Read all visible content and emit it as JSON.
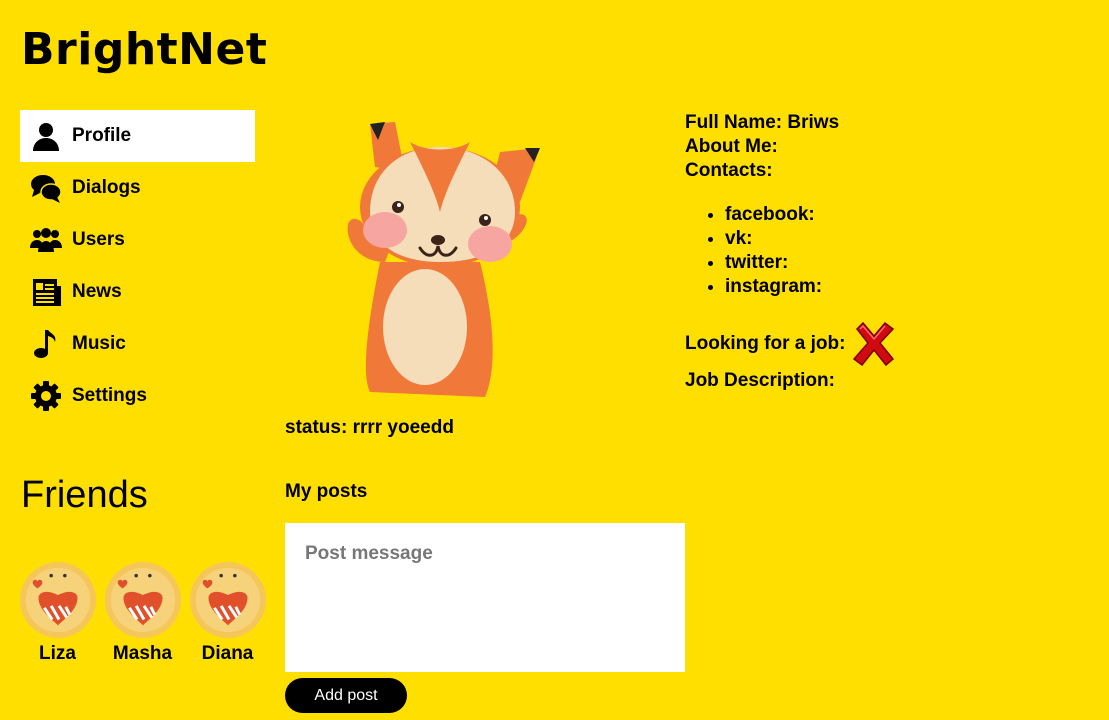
{
  "app": {
    "logo": "BrightNet"
  },
  "nav": {
    "items": [
      {
        "label": "Profile",
        "icon": "user-icon",
        "active": true
      },
      {
        "label": "Dialogs",
        "icon": "chat-icon",
        "active": false
      },
      {
        "label": "Users",
        "icon": "users-icon",
        "active": false
      },
      {
        "label": "News",
        "icon": "newspaper-icon",
        "active": false
      },
      {
        "label": "Music",
        "icon": "music-note-icon",
        "active": false
      },
      {
        "label": "Settings",
        "icon": "gear-icon",
        "active": false
      }
    ]
  },
  "friends": {
    "title": "Friends",
    "list": [
      {
        "name": "Liza"
      },
      {
        "name": "Masha"
      },
      {
        "name": "Diana"
      }
    ]
  },
  "profile": {
    "avatar": "fox-avatar",
    "status_label": "status: rrrr yoeedd",
    "full_name": "Full Name: Briws",
    "about_me": "About Me:",
    "contacts_label": "Contacts:",
    "contacts": [
      {
        "label": "facebook:"
      },
      {
        "label": "vk:"
      },
      {
        "label": "twitter:"
      },
      {
        "label": "instagram:"
      }
    ],
    "looking_for_job": "Looking for a job:",
    "looking_for_job_icon": "red-cross-icon",
    "job_description": "Job Description:"
  },
  "posts": {
    "title": "My posts",
    "input_placeholder": "Post message",
    "input_value": "",
    "add_button": "Add post"
  },
  "colors": {
    "background": "#FFDF00",
    "active_nav": "#FFFFFF",
    "button": "#000000"
  }
}
